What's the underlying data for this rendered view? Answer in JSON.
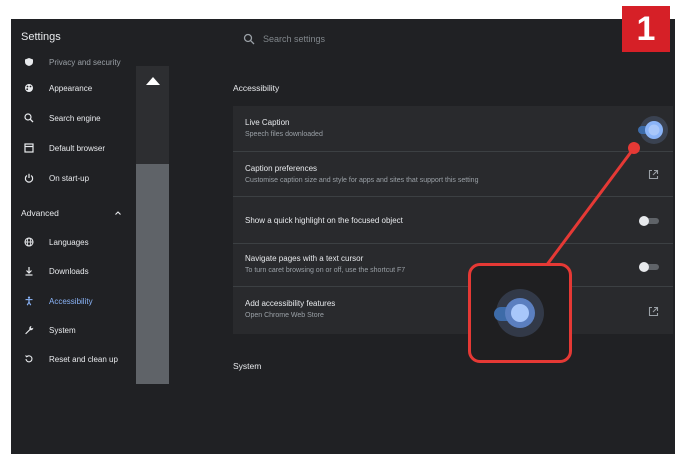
{
  "app": {
    "title": "Settings"
  },
  "search": {
    "placeholder": "Search settings"
  },
  "sidebar": {
    "items": [
      {
        "label": "Privacy and security",
        "icon": "shield-icon"
      },
      {
        "label": "Appearance",
        "icon": "palette-icon"
      },
      {
        "label": "Search engine",
        "icon": "search-icon"
      },
      {
        "label": "Default browser",
        "icon": "browser-icon"
      },
      {
        "label": "On start-up",
        "icon": "power-icon"
      }
    ],
    "advanced_label": "Advanced",
    "advanced_items": [
      {
        "label": "Languages",
        "icon": "globe-icon"
      },
      {
        "label": "Downloads",
        "icon": "download-icon"
      },
      {
        "label": "Accessibility",
        "icon": "accessibility-icon",
        "active": true
      },
      {
        "label": "System",
        "icon": "wrench-icon"
      },
      {
        "label": "Reset and clean up",
        "icon": "restore-icon"
      }
    ]
  },
  "accessibility": {
    "section_title": "Accessibility",
    "rows": [
      {
        "title": "Live Caption",
        "subtitle": "Speech files downloaded",
        "control": "toggle",
        "state": "on"
      },
      {
        "title": "Caption preferences",
        "subtitle": "Customise caption size and style for apps and sites that support this setting",
        "control": "external-link"
      },
      {
        "title": "Show a quick highlight on the focused object",
        "subtitle": "",
        "control": "toggle",
        "state": "off"
      },
      {
        "title": "Navigate pages with a text cursor",
        "subtitle": "To turn caret browsing on or off, use the shortcut F7",
        "control": "toggle",
        "state": "off"
      },
      {
        "title": "Add accessibility features",
        "subtitle": "Open Chrome Web Store",
        "control": "external-link"
      }
    ]
  },
  "system": {
    "section_title": "System"
  },
  "overlay": {
    "step_badge": "1"
  },
  "colors": {
    "background": "#202124",
    "card": "#292a2d",
    "accent": "#8ab4f8",
    "callout": "#e53935",
    "badge": "#d62027"
  }
}
